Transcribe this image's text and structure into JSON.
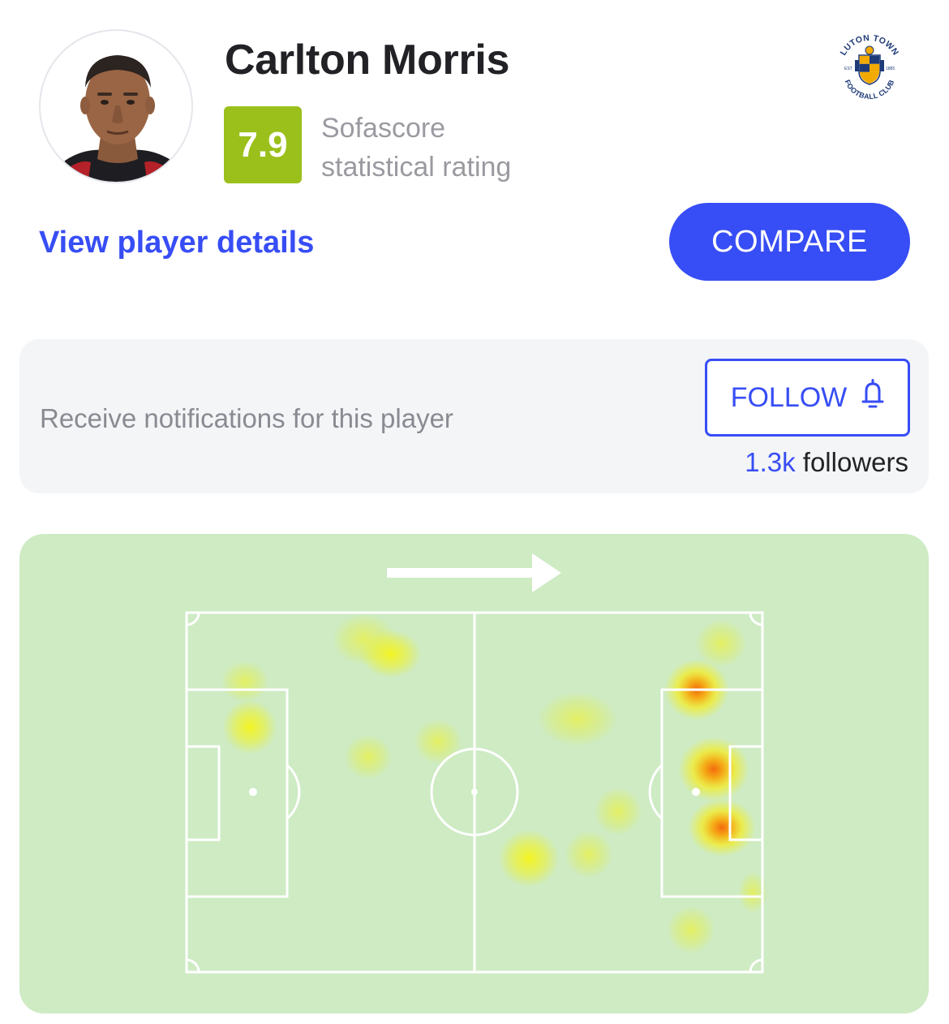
{
  "player": {
    "name": "Carlton Morris",
    "rating": "7.9",
    "rating_label_line1": "Sofascore",
    "rating_label_line2": "statistical rating"
  },
  "club": {
    "logo_text_top": "LUTON TOWN",
    "logo_text_bottom": "FOOTBALL CLUB",
    "logo_est": "EST",
    "logo_year": "1885"
  },
  "actions": {
    "details_link": "View player details",
    "compare_button": "COMPARE"
  },
  "notifications": {
    "text": "Receive notifications for this player",
    "follow_button": "FOLLOW",
    "followers_count": "1.3k",
    "followers_label": " followers"
  },
  "icons": {
    "bell": "bell-icon",
    "arrow": "attack-direction-arrow-icon"
  },
  "colors": {
    "accent": "#374df5",
    "rating_badge": "#9bc01c",
    "pitch_background": "#ceebc4"
  }
}
